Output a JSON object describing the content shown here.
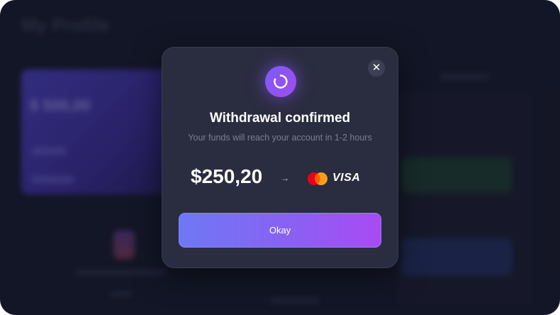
{
  "background": {
    "page_title": "My Profile",
    "balance": "$ 500,00"
  },
  "modal": {
    "title": "Withdrawal confirmed",
    "subtitle": "Your funds will reach your account in 1-2 hours",
    "amount": "$250,20",
    "arrow": "→",
    "card_brand": "VISA",
    "confirm_label": "Okay",
    "close_symbol": "✕",
    "icons": {
      "status": "spinner-icon",
      "close": "close-icon",
      "mastercard": "mastercard-icon"
    }
  },
  "colors": {
    "accent_start": "#6e78f4",
    "accent_end": "#a94af3",
    "modal_bg": "#2a2c3f",
    "page_bg": "#1a1c2e"
  }
}
